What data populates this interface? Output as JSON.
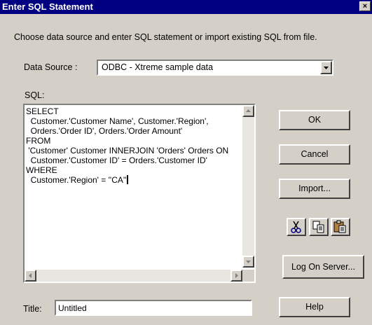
{
  "dialog": {
    "title": "Enter SQL Statement",
    "close_label": "×",
    "instruction": "Choose data source and enter SQL statement or import existing SQL from file."
  },
  "data_source": {
    "label": "Data Source :",
    "selected": "ODBC - Xtreme sample data"
  },
  "sql": {
    "label": "SQL:",
    "text": "SELECT\n  Customer.'Customer Name', Customer.'Region',\n  Orders.'Order ID', Orders.'Order Amount'\nFROM\n 'Customer' Customer INNERJOIN 'Orders' Orders ON\n  Customer.'Customer ID' = Orders.'Customer ID'\nWHERE\n  Customer.'Region' = ''CA''"
  },
  "buttons": {
    "ok": "OK",
    "cancel": "Cancel",
    "import": "Import...",
    "log_on_server": "Log On Server...",
    "help": "Help"
  },
  "edit_icons": [
    "cut-icon",
    "copy-icon",
    "paste-icon"
  ],
  "title_field": {
    "label": "Title:",
    "value": "Untitled"
  }
}
